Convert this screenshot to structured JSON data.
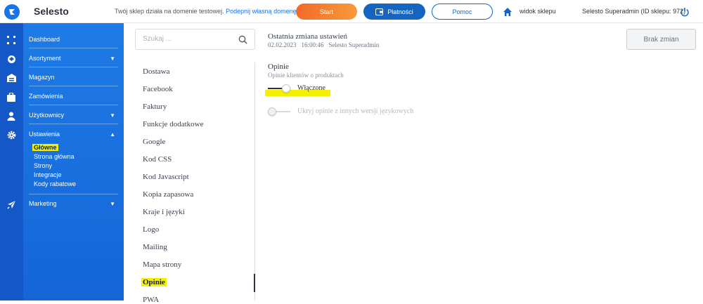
{
  "header": {
    "brand": "Selesto",
    "test_note": "Twój sklep działa na domenie testowej.",
    "test_link": "Podepnij własną domenę",
    "start_label": "Start",
    "payments_label": "Płatności",
    "help_label": "Pomoc",
    "shop_view_label": "widok sklepu",
    "account_label": "Selesto Superadmin (ID sklepu: 972)"
  },
  "sidebar": {
    "items": [
      {
        "label": "Dashboard",
        "caret": ""
      },
      {
        "label": "Asortyment",
        "caret": "▼"
      },
      {
        "label": "Magazyn",
        "caret": ""
      },
      {
        "label": "Zamówienia",
        "caret": ""
      },
      {
        "label": "Użytkownicy",
        "caret": "▼"
      },
      {
        "label": "Ustawienia",
        "caret": "▲"
      },
      {
        "label": "Marketing",
        "caret": "▼"
      }
    ],
    "subitems": [
      "Główne",
      "Strona główna",
      "Strony",
      "Integracje",
      "Kody rabatowe"
    ],
    "active_subitem": "Główne"
  },
  "settings_list": {
    "search_placeholder": "Szukaj ...",
    "items": [
      "Dostawa",
      "Facebook",
      "Faktury",
      "Funkcje dodatkowe",
      "Google",
      "Kod CSS",
      "Kod Javascript",
      "Kopia zapasowa",
      "Kraje i języki",
      "Logo",
      "Mailing",
      "Mapa strony",
      "Opinie",
      "PWA"
    ],
    "active_item": "Opinie"
  },
  "main": {
    "last_change_title": "Ostatnia zmiana ustawień",
    "last_change_date": "02.02.2023",
    "last_change_time": "16:00:46",
    "last_change_user": "Selesto Superadmin",
    "no_changes_label": "Brak zmian",
    "section_title": "Opinie",
    "section_subtitle": "Opinie klientów o produktach",
    "toggles": [
      {
        "label": "Włączone",
        "on": true
      },
      {
        "label": "Ukryj opinie z innych wersji językowych",
        "on": false
      }
    ]
  },
  "colors": {
    "accent": "#1565c0",
    "sidebar": "#1e7be6",
    "highlight": "#f4f000",
    "start_button": "#f26a2a"
  }
}
